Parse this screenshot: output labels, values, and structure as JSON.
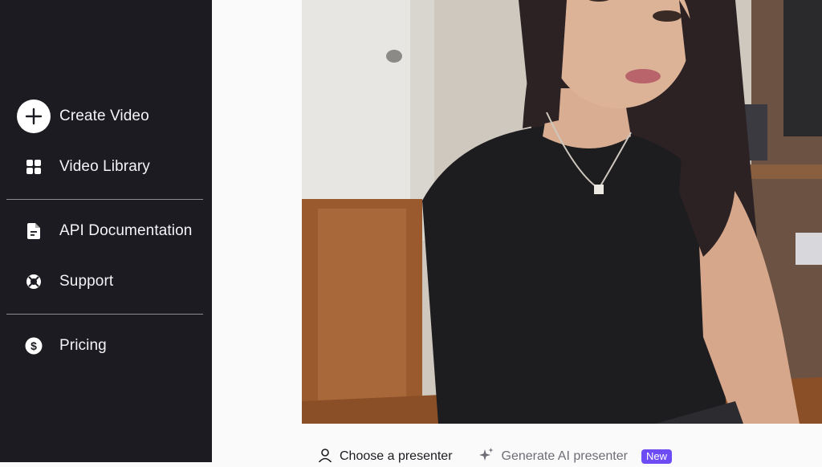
{
  "sidebar": {
    "items": [
      {
        "label": "Create Video",
        "icon": "plus-icon"
      },
      {
        "label": "Video Library",
        "icon": "grid-icon"
      },
      {
        "label": "API Documentation",
        "icon": "document-icon"
      },
      {
        "label": "Support",
        "icon": "lifebuoy-icon"
      },
      {
        "label": "Pricing",
        "icon": "dollar-icon"
      }
    ]
  },
  "main": {
    "tabs": {
      "choose_label": "Choose a presenter",
      "generate_label": "Generate AI presenter",
      "new_badge": "New"
    }
  },
  "colors": {
    "sidebar_bg": "#1c1b21",
    "accent": "#6d4cf5",
    "page_bg": "#fafafa"
  }
}
